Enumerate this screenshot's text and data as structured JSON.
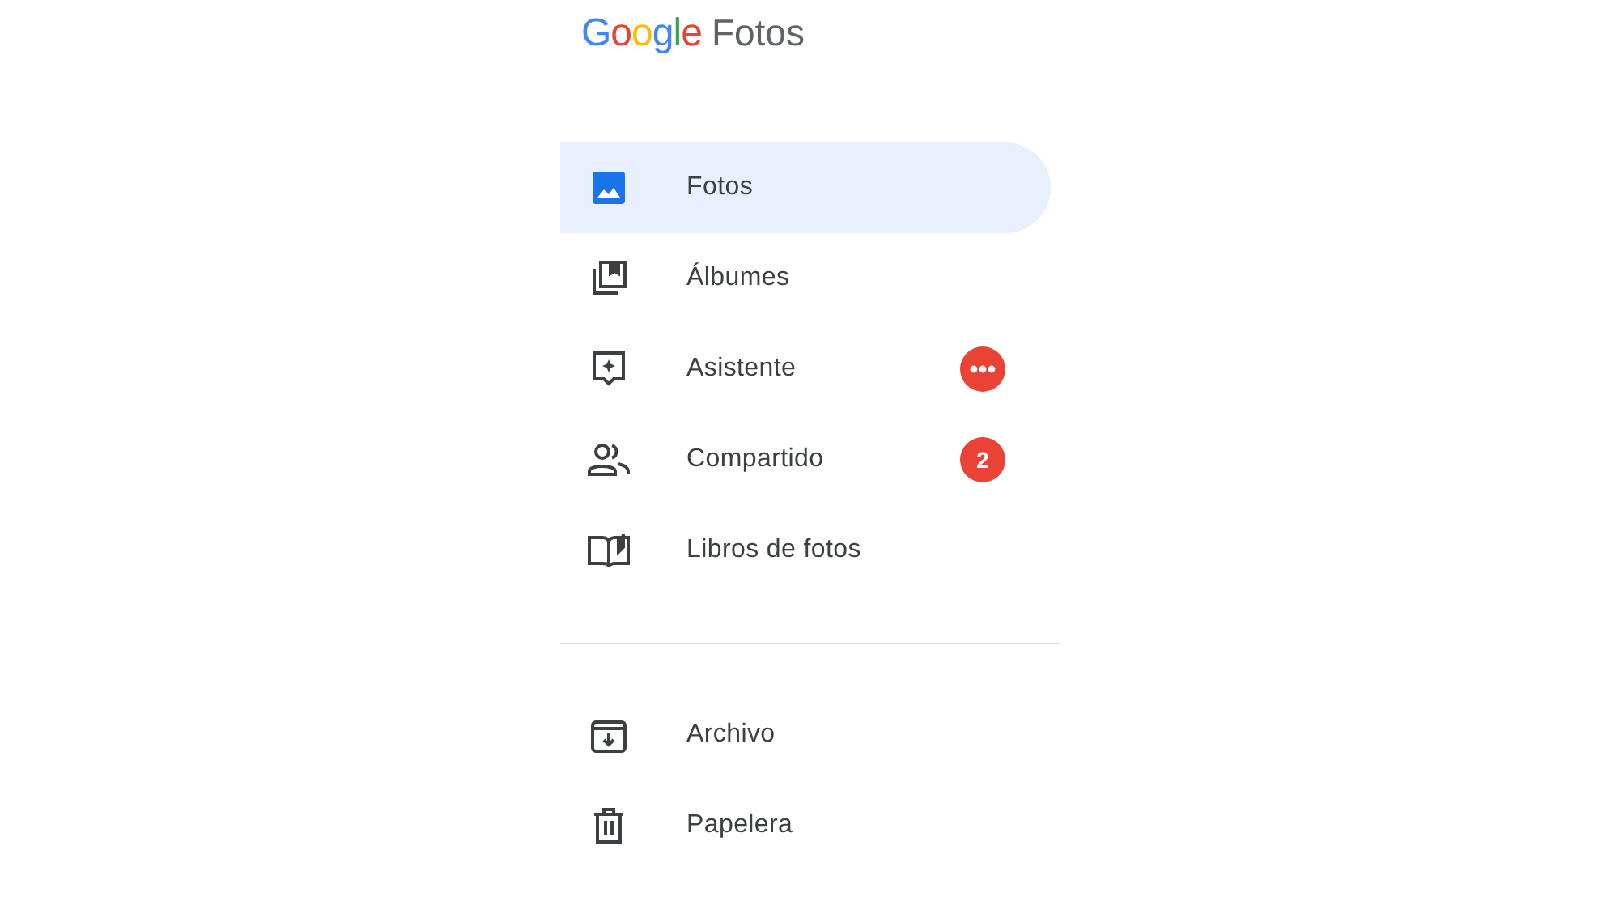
{
  "logo": {
    "brand": "Google",
    "product": "Fotos"
  },
  "sections": [
    {
      "items": [
        {
          "kind": "photo",
          "label": "Fotos",
          "selected": true
        },
        {
          "kind": "albums",
          "label": "Álbumes",
          "selected": false
        },
        {
          "kind": "assistant",
          "label": "Asistente",
          "selected": false,
          "badge": {
            "kind": "dots"
          }
        },
        {
          "kind": "shared",
          "label": "Compartido",
          "selected": false,
          "badge": {
            "kind": "count",
            "text": "2"
          }
        },
        {
          "kind": "book",
          "label": "Libros de fotos",
          "selected": false
        }
      ]
    },
    {
      "items": [
        {
          "kind": "archive",
          "label": "Archivo",
          "selected": false
        },
        {
          "kind": "trash",
          "label": "Papelera",
          "selected": false
        }
      ]
    }
  ]
}
